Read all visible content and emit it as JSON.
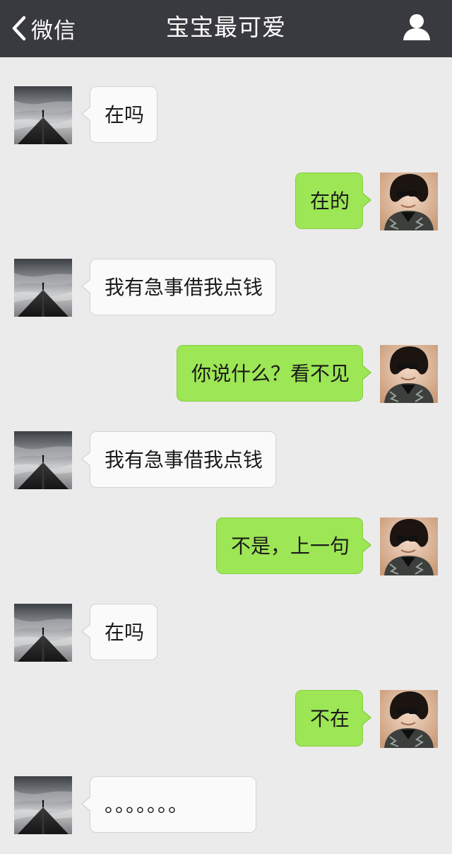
{
  "header": {
    "back_label": "微信",
    "title": "宝宝最可爱",
    "back_icon": "chevron-left-icon",
    "profile_icon": "person-icon"
  },
  "colors": {
    "header_bg": "#393a3f",
    "chat_bg": "#ebebeb",
    "incoming_bubble": "#fafafa",
    "outgoing_bubble": "#9de655"
  },
  "messages": [
    {
      "direction": "incoming",
      "text": "在吗"
    },
    {
      "direction": "outgoing",
      "text": "在的"
    },
    {
      "direction": "incoming",
      "text": "我有急事借我点钱"
    },
    {
      "direction": "outgoing",
      "text": "你说什么？看不见"
    },
    {
      "direction": "incoming",
      "text": "我有急事借我点钱"
    },
    {
      "direction": "outgoing",
      "text": "不是，上一句"
    },
    {
      "direction": "incoming",
      "text": "在吗"
    },
    {
      "direction": "outgoing",
      "text": "不在"
    },
    {
      "direction": "incoming",
      "text": "。。。。。。。"
    }
  ]
}
